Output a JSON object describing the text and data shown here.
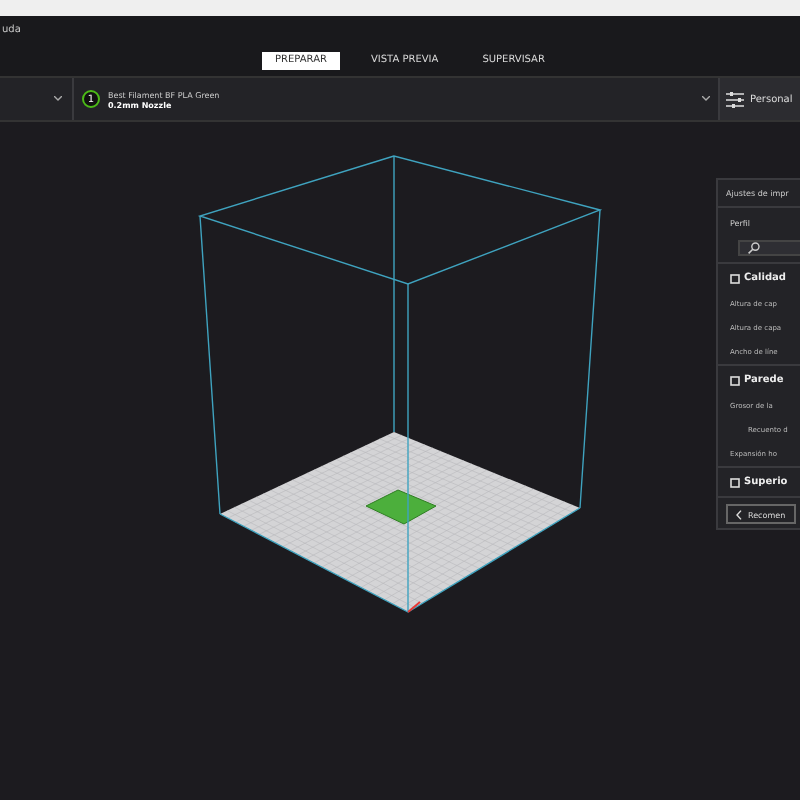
{
  "window": {
    "title": "uda"
  },
  "tabs": [
    {
      "label": "PREPARAR",
      "selected": true
    },
    {
      "label": "VISTA PREVIA",
      "selected": false
    },
    {
      "label": "SUPERVISAR",
      "selected": false
    }
  ],
  "extruder": {
    "number": "1",
    "material": "Best Filament BF PLA Green",
    "nozzle": "0.2mm Nozzle"
  },
  "settings_button": {
    "label": "Personal"
  },
  "panel": {
    "title": "Ajustes de impr",
    "profile_label": "Perfil",
    "items": [
      {
        "kind": "section",
        "label": "Calidad"
      },
      {
        "kind": "setting",
        "label": "Altura de cap"
      },
      {
        "kind": "setting",
        "label": "Altura de capa"
      },
      {
        "kind": "setting",
        "label": "Ancho de líne"
      },
      {
        "kind": "section",
        "label": "Parede"
      },
      {
        "kind": "setting",
        "label": "Grosor de la"
      },
      {
        "kind": "subsetting",
        "label": "Recuento d"
      },
      {
        "kind": "setting",
        "label": "Expansión ho"
      },
      {
        "kind": "section",
        "label": "Superio"
      }
    ],
    "back_button": {
      "label": "Recomen"
    }
  }
}
